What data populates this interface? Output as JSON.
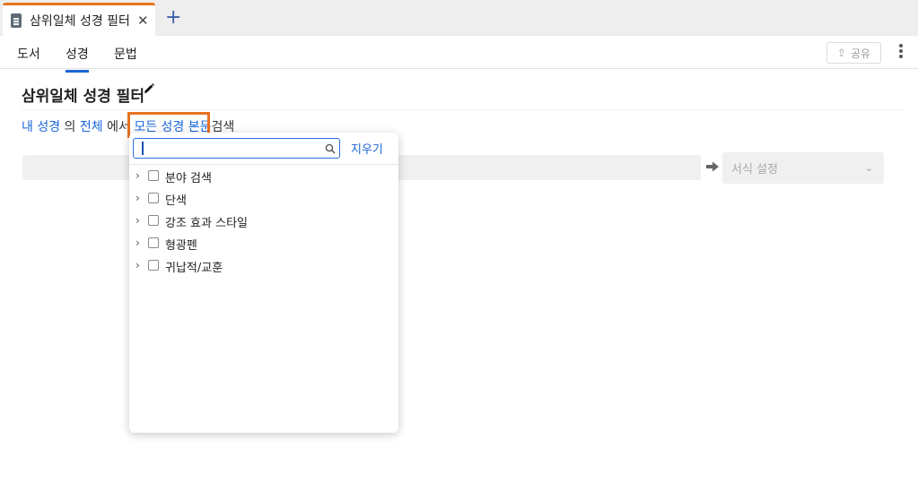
{
  "tab": {
    "title": "삼위일체 성경 필터",
    "close_glyph": "✕",
    "new_tab_glyph": "+"
  },
  "subnav": {
    "items": [
      {
        "label": "도서",
        "active": false
      },
      {
        "label": "성경",
        "active": true
      },
      {
        "label": "문법",
        "active": false
      }
    ],
    "share_label": "공유"
  },
  "heading": {
    "title": "삼위일체 성경 필터"
  },
  "query": {
    "source": "내 성경",
    "particle1": "의",
    "range": "전체",
    "particle2": "에서",
    "scope": "모든 성경 본문",
    "action": "검색"
  },
  "filter": {
    "format_placeholder": "서식 설정"
  },
  "dropdown": {
    "search_value": "",
    "clear_label": "지우기",
    "items": [
      {
        "label": "분야 검색",
        "checked": false
      },
      {
        "label": "단색",
        "checked": false
      },
      {
        "label": "강조 효과 스타일",
        "checked": false
      },
      {
        "label": "형광펜",
        "checked": false
      },
      {
        "label": "귀납적/교훈",
        "checked": false
      }
    ]
  },
  "colors": {
    "accent_orange": "#e8731f",
    "link_blue": "#1a66d9"
  }
}
